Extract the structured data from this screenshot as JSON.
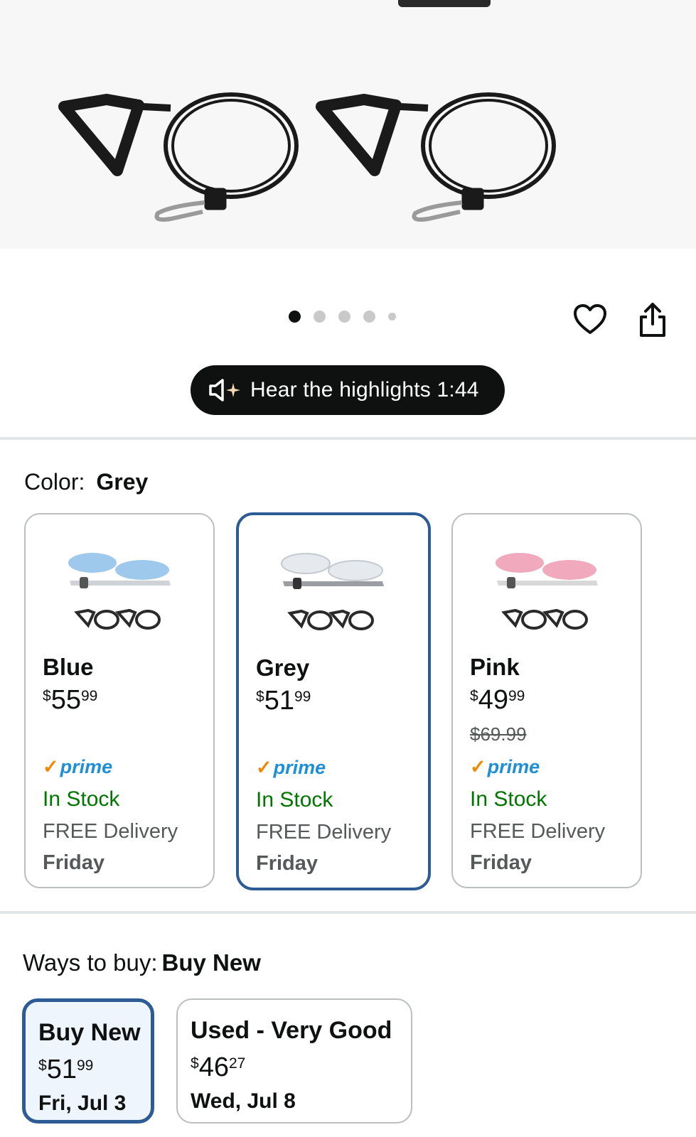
{
  "gallery": {
    "dot_count": 5,
    "active_index": 0
  },
  "actions": {
    "favorite_icon": "heart-icon",
    "share_icon": "share-icon"
  },
  "audio": {
    "label": "Hear the highlights 1:44"
  },
  "color": {
    "label": "Color:",
    "selected": "Grey"
  },
  "variants": [
    {
      "name": "Blue",
      "currency": "$",
      "price_whole": "55",
      "price_fraction": "99",
      "list_price": "",
      "prime": "prime",
      "stock": "In Stock",
      "delivery": "FREE Delivery",
      "day": "Friday",
      "accent": "#9ec9ec"
    },
    {
      "name": "Grey",
      "currency": "$",
      "price_whole": "51",
      "price_fraction": "99",
      "list_price": "",
      "prime": "prime",
      "stock": "In Stock",
      "delivery": "FREE Delivery",
      "day": "Friday",
      "accent": "#e6e9ee"
    },
    {
      "name": "Pink",
      "currency": "$",
      "price_whole": "49",
      "price_fraction": "99",
      "list_price": "$69.99",
      "prime": "prime",
      "stock": "In Stock",
      "delivery": "FREE Delivery",
      "day": "Friday",
      "accent": "#f1a9bd"
    }
  ],
  "ways": {
    "label": "Ways to buy:",
    "selected": "Buy New",
    "options": [
      {
        "title": "Buy New",
        "currency": "$",
        "price_whole": "51",
        "price_fraction": "99",
        "date": "Fri, Jul 3"
      },
      {
        "title": "Used - Very Good",
        "currency": "$",
        "price_whole": "46",
        "price_fraction": "27",
        "date": "Wed, Jul 8"
      }
    ]
  },
  "colors": {
    "selected_border": "#2d5c94",
    "prime_blue": "#1f8fd6",
    "prime_check": "#f08804",
    "in_stock": "#007600"
  }
}
